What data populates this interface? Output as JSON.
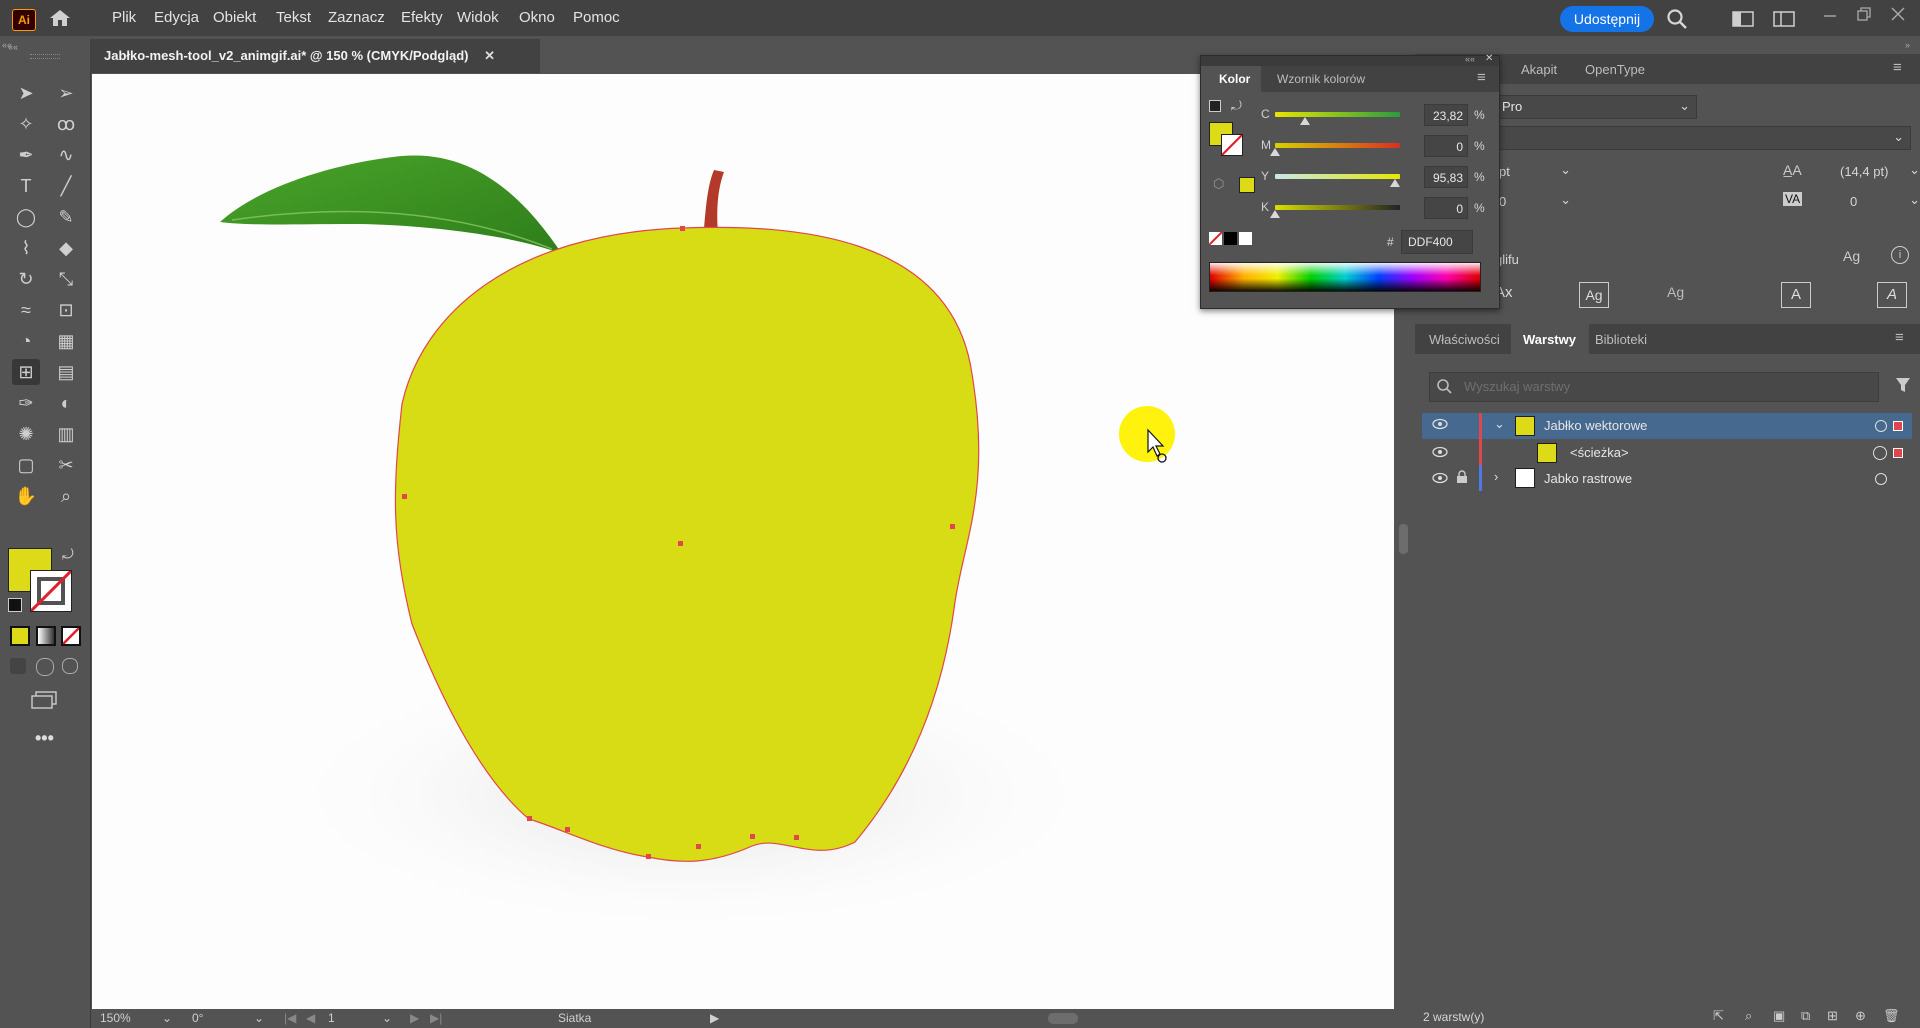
{
  "menu": {
    "app_icon": "Ai",
    "items": [
      "Plik",
      "Edycja",
      "Obiekt",
      "Tekst",
      "Zaznacz",
      "Efekty",
      "Widok",
      "Okno",
      "Pomoc"
    ],
    "share_label": "Udostępnij"
  },
  "document": {
    "tab_title": "Jabłko-mesh-tool_v2_animgif.ai* @ 150 % (CMYK/Podgląd)"
  },
  "color_panel": {
    "tabs": [
      "Kolor",
      "Wzornik kolorów"
    ],
    "channels": [
      {
        "label": "C",
        "value": "23,82",
        "unit": "%",
        "level": 0.2382
      },
      {
        "label": "M",
        "value": "0",
        "unit": "%",
        "level": 0
      },
      {
        "label": "Y",
        "value": "95,83",
        "unit": "%",
        "level": 0.9583
      },
      {
        "label": "K",
        "value": "0",
        "unit": "%",
        "level": 0
      }
    ],
    "hash_label": "#",
    "hex": "DDF400",
    "fill_color": "#DDDA18"
  },
  "character_panel": {
    "tabs": [
      "Akapit",
      "OpenType"
    ],
    "font_name": "Pro",
    "leading": "(14,4 pt)",
    "tracking": "0",
    "size_partial": "pt",
    "kerning_partial": "0",
    "glyph_label": "glifu"
  },
  "layers_panel": {
    "tabs": [
      "Właściwości",
      "Warstwy",
      "Biblioteki"
    ],
    "search_placeholder": "Wyszukaj warstwy",
    "layers": [
      {
        "name": "Jabłko wektorowe",
        "color": "#e0474c",
        "expanded": true,
        "selected": true
      },
      {
        "name": "<ścieżka>",
        "color": "#e0474c",
        "expanded": false,
        "selected": false
      },
      {
        "name": "Jabko rastrowe",
        "color": "#4f7be0",
        "expanded": false,
        "selected": false
      }
    ],
    "footer_count": "2 warstw(y)"
  },
  "status": {
    "zoom": "150%",
    "rotation": "0°",
    "artboard": "1",
    "tool_name": "Siatka"
  },
  "tools": [
    "selection-tool",
    "direct-selection-tool",
    "magic-wand-tool",
    "lasso-tool",
    "pen-tool",
    "curvature-tool",
    "type-tool",
    "line-tool",
    "ellipse-tool",
    "paintbrush-tool",
    "shaper-tool",
    "eraser-tool",
    "rotate-tool",
    "scale-tool",
    "warp-tool",
    "free-transform-tool",
    "shape-builder-tool",
    "perspective-grid-tool",
    "mesh-tool",
    "gradient-tool",
    "eyedropper-tool",
    "blend-tool",
    "symbol-sprayer-tool",
    "column-graph-tool",
    "artboard-tool",
    "slice-tool",
    "hand-tool",
    "zoom-tool"
  ]
}
